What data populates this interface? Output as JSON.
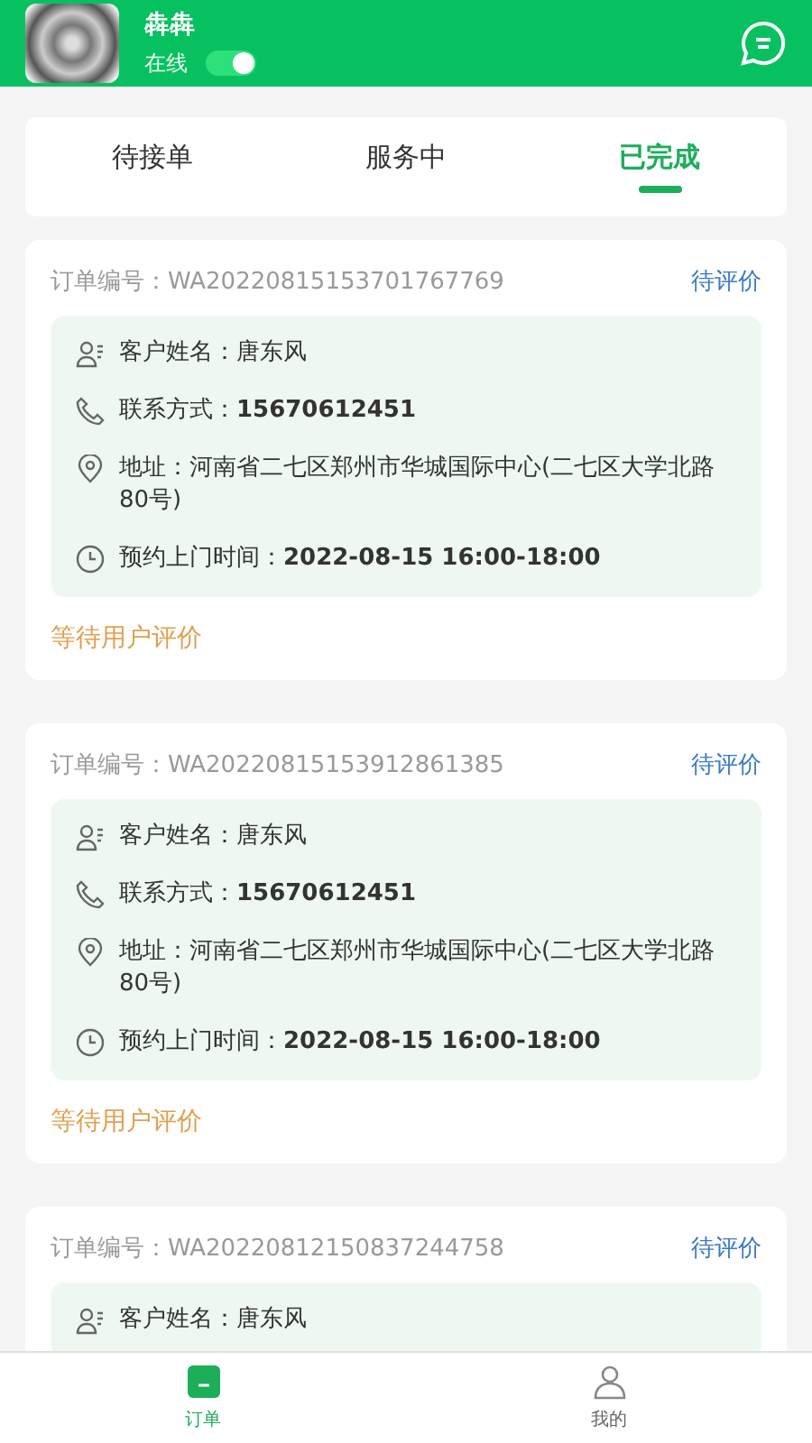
{
  "header": {
    "name": "犇犇",
    "status_label": "在线",
    "online": true
  },
  "tabs": [
    {
      "label": "待接单",
      "selected": false
    },
    {
      "label": "服务中",
      "selected": false
    },
    {
      "label": "已完成",
      "selected": true
    }
  ],
  "orders": [
    {
      "order_no": "订单编号：WA20220815153701767769",
      "status": "待评价",
      "rows": [
        {
          "kind": "name",
          "label": "客户姓名：",
          "value": "唐东风"
        },
        {
          "kind": "phone",
          "label": "联系方式：",
          "value": "15670612451"
        },
        {
          "kind": "address",
          "label": "地址：",
          "value": "河南省二七区郑州市华城国际中心(二七区大学北路80号)"
        },
        {
          "kind": "time",
          "label": "预约上门时间：",
          "value": "2022-08-15 16:00-18:00"
        }
      ],
      "footer": "等待用户评价"
    },
    {
      "order_no": "订单编号：WA20220815153912861385",
      "status": "待评价",
      "rows": [
        {
          "kind": "name",
          "label": "客户姓名：",
          "value": "唐东风"
        },
        {
          "kind": "phone",
          "label": "联系方式：",
          "value": "15670612451"
        },
        {
          "kind": "address",
          "label": "地址：",
          "value": "河南省二七区郑州市华城国际中心(二七区大学北路80号)"
        },
        {
          "kind": "time",
          "label": "预约上门时间：",
          "value": "2022-08-15 16:00-18:00"
        }
      ],
      "footer": "等待用户评价"
    },
    {
      "order_no": "订单编号：WA20220812150837244758",
      "status": "待评价",
      "rows": [
        {
          "kind": "name",
          "label": "客户姓名：",
          "value": "唐东风"
        }
      ]
    }
  ],
  "bottom_nav": [
    {
      "label": "订单",
      "kind": "orders",
      "selected": true
    },
    {
      "label": "我的",
      "kind": "profile",
      "selected": false
    }
  ]
}
